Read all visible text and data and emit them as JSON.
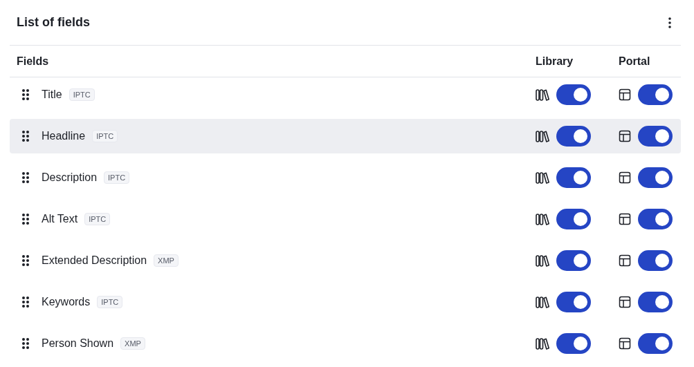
{
  "panel": {
    "title": "List of fields"
  },
  "columns": [
    "Fields",
    "Library",
    "Portal"
  ],
  "rows": [
    {
      "name": "Title",
      "tag": "IPTC",
      "selected": false,
      "library_on": true,
      "portal_on": true
    },
    {
      "name": "Headline",
      "tag": "IPTC",
      "selected": true,
      "library_on": true,
      "portal_on": true
    },
    {
      "name": "Description",
      "tag": "IPTC",
      "selected": false,
      "library_on": true,
      "portal_on": true
    },
    {
      "name": "Alt Text",
      "tag": "IPTC",
      "selected": false,
      "library_on": true,
      "portal_on": true
    },
    {
      "name": "Extended Description",
      "tag": "XMP",
      "selected": false,
      "library_on": true,
      "portal_on": true
    },
    {
      "name": "Keywords",
      "tag": "IPTC",
      "selected": false,
      "library_on": true,
      "portal_on": true
    },
    {
      "name": "Person Shown",
      "tag": "XMP",
      "selected": false,
      "library_on": true,
      "portal_on": true
    }
  ]
}
